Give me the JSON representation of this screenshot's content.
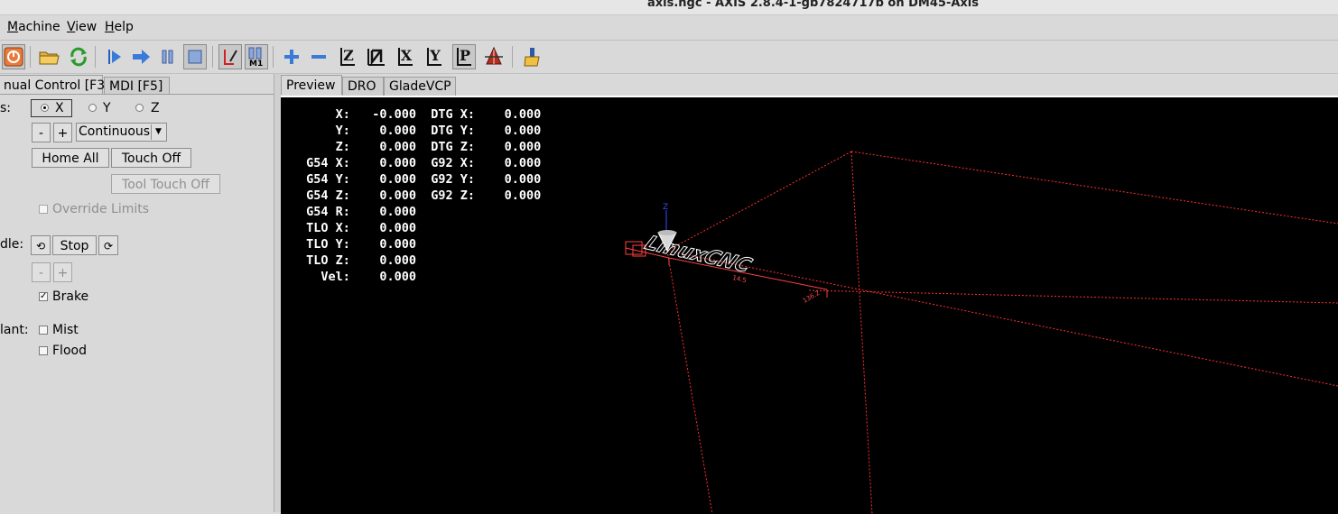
{
  "window": {
    "title": "axis.ngc - AXIS 2.8.4-1-gb7824717b on DM45-Axis"
  },
  "menu": {
    "items": [
      {
        "label": "Machine",
        "underline": "M"
      },
      {
        "label": "View",
        "underline": "V"
      },
      {
        "label": "Help",
        "underline": "H"
      }
    ]
  },
  "toolbar": {
    "icons": [
      "estop-icon",
      "power-icon",
      "open-file-icon",
      "reload-icon",
      "run-icon",
      "step-icon",
      "pause-icon",
      "stop-icon",
      "block-delete-icon",
      "optional-stop-icon",
      "zoom-in-icon",
      "zoom-out-icon",
      "view-z-icon",
      "view-z2-icon",
      "view-x-icon",
      "view-y-icon",
      "view-p-icon",
      "rotate-icon",
      "clear-backplot-icon"
    ],
    "view_labels": {
      "z": "Z",
      "x": "X",
      "y": "Y",
      "p": "P"
    },
    "optional_stop_label": "M1"
  },
  "left_tabs": [
    {
      "label": "nual Control [F3]",
      "active": true
    },
    {
      "label": "MDI [F5]",
      "active": false
    }
  ],
  "manual": {
    "axis_label": "s:",
    "axes": [
      "X",
      "Y",
      "Z"
    ],
    "selected_axis": "X",
    "jog_minus": "-",
    "jog_plus": "+",
    "jog_mode": "Continuous",
    "home_all": "Home All",
    "touch_off": "Touch Off",
    "tool_touch_off": "Tool Touch Off",
    "override_limits": "Override Limits",
    "spindle_label": "dle:",
    "spindle_stop": "Stop",
    "speed_minus": "-",
    "speed_plus": "+",
    "brake": "Brake",
    "brake_checked": true,
    "coolant_label": "lant:",
    "mist": "Mist",
    "flood": "Flood"
  },
  "right_tabs": [
    "Preview",
    "DRO",
    "GladeVCP"
  ],
  "dro": {
    "rows": [
      "     X:   -0.000  DTG X:    0.000",
      "     Y:    0.000  DTG Y:    0.000",
      "     Z:    0.000  DTG Z:    0.000",
      " G54 X:    0.000  G92 X:    0.000",
      " G54 Y:    0.000  G92 Y:    0.000",
      " G54 Z:    0.000  G92 Z:    0.000",
      " G54 R:    0.000",
      " TLO X:    0.000",
      " TLO Y:    0.000",
      " TLO Z:    0.000",
      "   Vel:    0.000"
    ]
  },
  "preview": {
    "toolpath_text": "LinuxCNC",
    "axis_z_label": "Z",
    "dim_x": "136.2",
    "dim_y": "14.5",
    "colors": {
      "limits": "#ff3030",
      "toolpath": "#ffffff",
      "origin": "#ff4040",
      "axis_z": "#3050ff",
      "background": "#000000"
    }
  }
}
